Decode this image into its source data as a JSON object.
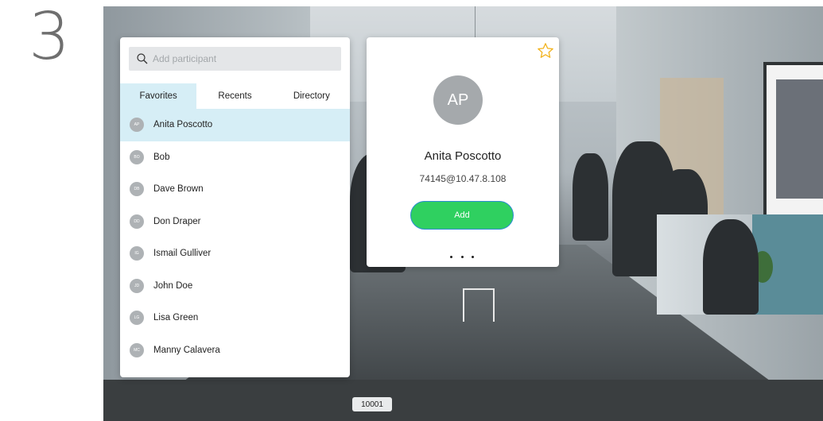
{
  "step_number": "3",
  "search": {
    "placeholder": "Add participant",
    "icon": "search-icon"
  },
  "tabs": [
    {
      "label": "Favorites",
      "active": true
    },
    {
      "label": "Recents",
      "active": false
    },
    {
      "label": "Directory",
      "active": false
    }
  ],
  "contacts": [
    {
      "initials": "AP",
      "name": "Anita Poscotto",
      "selected": true
    },
    {
      "initials": "BO",
      "name": "Bob"
    },
    {
      "initials": "DB",
      "name": "Dave Brown"
    },
    {
      "initials": "DD",
      "name": "Don Draper"
    },
    {
      "initials": "IG",
      "name": "Ismail Gulliver"
    },
    {
      "initials": "JD",
      "name": "John Doe"
    },
    {
      "initials": "LG",
      "name": "Lisa Green"
    },
    {
      "initials": "MC",
      "name": "Manny Calavera"
    }
  ],
  "detail": {
    "initials": "AP",
    "name": "Anita Poscotto",
    "address": "74145@10.47.8.108",
    "add_label": "Add",
    "favorite_icon": "star-icon",
    "more_icon": "more-options-icon"
  },
  "call": {
    "caller_id": "10001"
  },
  "colors": {
    "accent_green": "#2fd060",
    "selection_blue": "#d6eef6",
    "focus_outline": "#2c8bd1",
    "star": "#f2b21b"
  }
}
